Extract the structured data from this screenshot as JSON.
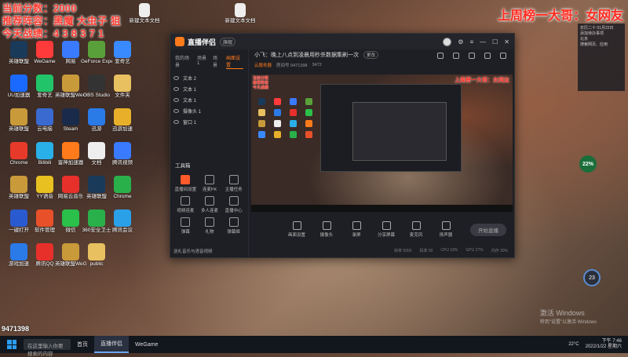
{
  "overlay": {
    "score_line": "当前分数：2000",
    "lineup_line": "推荐阵容：黑魔 大虫子 狙",
    "record_line": "今天战绩：4 3 8 3 7 1",
    "banner": "上周榜一大哥：女网友",
    "viewer_count": "9471398"
  },
  "desktop_icons": [
    {
      "label": "英雄联盟",
      "color": "#1a3a5a"
    },
    {
      "label": "WeGame",
      "color": "#ff3a3a"
    },
    {
      "label": "网易",
      "color": "#3a7aff"
    },
    {
      "label": "GeForce Experience",
      "color": "#5aa03a"
    },
    {
      "label": "爱奇艺",
      "color": "#3a8aff"
    },
    {
      "label": "UU加速器",
      "color": "#1a6aff"
    },
    {
      "label": "爱奇艺",
      "color": "#22c46a"
    },
    {
      "label": "英雄联盟WeGame",
      "color": "#c89a3a"
    },
    {
      "label": "OBS Studio",
      "color": "#333"
    },
    {
      "label": "文件夹",
      "color": "#e8c060"
    },
    {
      "label": "英雄联盟",
      "color": "#c89a3a"
    },
    {
      "label": "云电脑",
      "color": "#3a6ad0"
    },
    {
      "label": "Steam",
      "color": "#1a2a4a"
    },
    {
      "label": "迅游",
      "color": "#2a7ae8"
    },
    {
      "label": "迅游加速",
      "color": "#e8b02a"
    },
    {
      "label": "Chrome",
      "color": "#e83a2a"
    },
    {
      "label": "Bilibili",
      "color": "#2ab0e8"
    },
    {
      "label": "雷神加速器",
      "color": "#ff7a1a"
    },
    {
      "label": "文档",
      "color": "#eee"
    },
    {
      "label": "腾讯视频",
      "color": "#3a7aff"
    },
    {
      "label": "英雄联盟",
      "color": "#c89a3a"
    },
    {
      "label": "YY语音",
      "color": "#e8c020"
    },
    {
      "label": "网易云音乐",
      "color": "#e8302a"
    },
    {
      "label": "英雄联盟",
      "color": "#1a3a5a"
    },
    {
      "label": "Chrome",
      "color": "#2ab04a"
    },
    {
      "label": "一键打开",
      "color": "#2a5ad0"
    },
    {
      "label": "软件管理",
      "color": "#e8502a"
    },
    {
      "label": "微信",
      "color": "#2ac04a"
    },
    {
      "label": "360安全卫士",
      "color": "#2ab04a"
    },
    {
      "label": "腾讯会议",
      "color": "#2aa0e8"
    },
    {
      "label": "游戏加速",
      "color": "#2a7ae8"
    },
    {
      "label": "腾讯QQ",
      "color": "#e8302a"
    },
    {
      "label": "英雄联盟WeGame",
      "color": "#c89a3a"
    },
    {
      "label": "public",
      "color": "#e8c060"
    }
  ],
  "top_files": [
    {
      "label": "新建文本文档"
    },
    {
      "label": "新建文本文档"
    }
  ],
  "app": {
    "name": "直播伴侣",
    "version": "旗舰",
    "side_tabs": [
      "我的场景",
      "场景1",
      "场景",
      "画面设置"
    ],
    "sources": [
      {
        "label": "文本 2"
      },
      {
        "label": "文本 1"
      },
      {
        "label": "文本 1"
      },
      {
        "label": "摄像头 1"
      },
      {
        "label": "窗口 1"
      }
    ],
    "tools_title": "工具箱",
    "tools": [
      {
        "label": "直播间设置",
        "hot": true
      },
      {
        "label": "连麦PK",
        "hot": false
      },
      {
        "label": "主播任务",
        "hot": false
      },
      {
        "label": "视频连麦",
        "hot": false
      },
      {
        "label": "多人连麦",
        "hot": false
      },
      {
        "label": "直播中心",
        "hot": false
      },
      {
        "label": "弹幕",
        "hot": false
      },
      {
        "label": "礼物",
        "hot": false
      },
      {
        "label": "弹幕姬",
        "hot": false
      }
    ],
    "side_footer": "送礼音乐与语音视频",
    "room_title": "小飞：晚上八点到凌晨用秒杀数据集刷一次",
    "room_btn": "更改",
    "room_meta_tag": "云服务器",
    "room_meta_id": "房间号 9471398",
    "room_meta_count": "3472",
    "preview_banner": "上周榜一大哥：女网友",
    "preview_stats": [
      "当前分数",
      "推荐阵容",
      "今天战绩"
    ],
    "controls": [
      "画面设置",
      "摄像头",
      "录屏",
      "分享屏幕",
      "麦克风",
      "扬声器"
    ],
    "go_live_label": "开始直播",
    "status": [
      "帧率 5000",
      "码率 60",
      "CPU 18%",
      "GPU 27%",
      "内存 30%"
    ]
  },
  "widgets": {
    "weather_lines": [
      "农历二十  01月22日",
      "添加待办事项",
      "北京",
      "搜索网页、应用"
    ],
    "gauge": "22%",
    "gauge2": "23",
    "activate_title": "激活 Windows",
    "activate_sub": "转到\"设置\"以激活 Windows"
  },
  "taskbar": {
    "search_placeholder": "在这里输入你要搜索的内容",
    "apps": [
      "首页",
      "直播伴侣",
      "WeGame"
    ],
    "weather": "22°C",
    "time": "下午 7:46",
    "date": "2022/1/22 星期六"
  }
}
